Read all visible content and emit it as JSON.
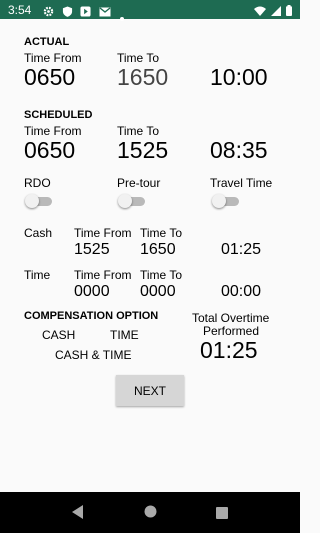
{
  "status_bar": {
    "time": "3:54",
    "icons": [
      "settings-icon",
      "shield-icon",
      "play-icon",
      "gmail-icon",
      "dot-icon",
      "wifi-icon",
      "signal-icon",
      "battery-icon"
    ],
    "color": "#1e6b52"
  },
  "actual": {
    "heading": "ACTUAL",
    "time_from_label": "Time From",
    "time_from_value": "0650",
    "time_to_label": "Time To",
    "time_to_value": "1650",
    "duration": "10:00"
  },
  "scheduled": {
    "heading": "SCHEDULED",
    "time_from_label": "Time From",
    "time_from_value": "0650",
    "time_to_label": "Time To",
    "time_to_value": "1525",
    "duration": "08:35"
  },
  "toggles": [
    {
      "label": "RDO",
      "on": false
    },
    {
      "label": "Pre-tour",
      "on": false
    },
    {
      "label": "Travel Time",
      "on": false
    }
  ],
  "cash_row": {
    "label": "Cash",
    "time_from_label": "Time From",
    "time_from_value": "1525",
    "time_to_label": "Time To",
    "time_to_value": "1650",
    "duration": "01:25"
  },
  "time_row": {
    "label": "Time",
    "time_from_label": "Time From",
    "time_from_value": "0000",
    "time_to_label": "Time To",
    "time_to_value": "0000",
    "duration": "00:00"
  },
  "compensation": {
    "heading": "COMPENSATION OPTION",
    "options": [
      "CASH",
      "TIME",
      "CASH & TIME"
    ]
  },
  "total_overtime": {
    "label_line1": "Total Overtime",
    "label_line2": "Performed",
    "value": "01:25"
  },
  "next_button": "NEXT",
  "nav_bar": {
    "icons": [
      "back-icon",
      "home-icon",
      "recents-icon"
    ]
  }
}
